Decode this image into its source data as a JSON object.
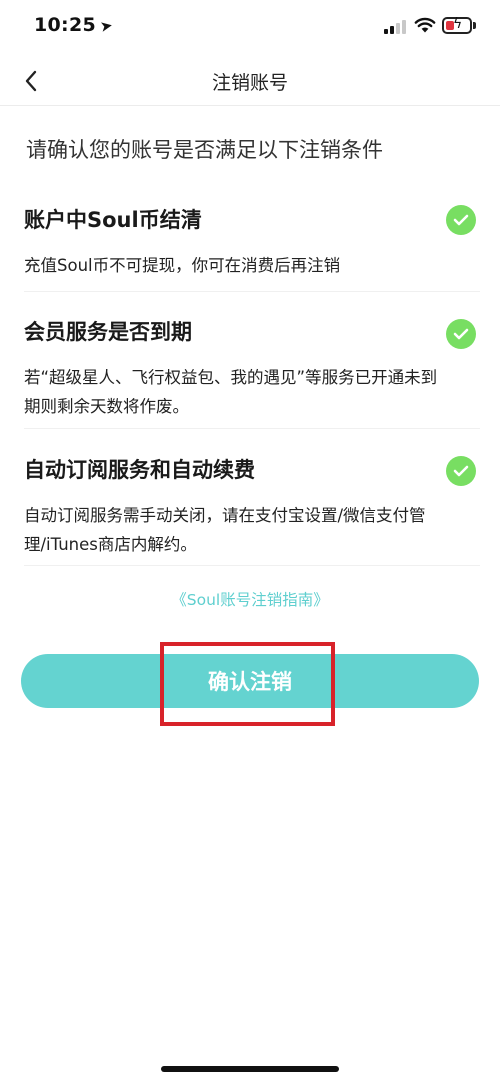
{
  "status_bar": {
    "time": "10:25",
    "location_icon": "location-arrow-icon",
    "signal_icon": "cellular-signal-icon",
    "wifi_icon": "wifi-icon",
    "battery_icon": "battery-charging-icon",
    "battery_color": "#e0343f"
  },
  "nav": {
    "back_icon": "chevron-left-icon",
    "title": "注销账号"
  },
  "intro": "请确认您的账号是否满足以下注销条件",
  "conditions": [
    {
      "title": "账户中Soul币结清",
      "desc": "充值Soul币不可提现，你可在消费后再注销",
      "icon": "check-circle-icon"
    },
    {
      "title": "会员服务是否到期",
      "desc": "若“超级星人、飞行权益包、我的遇见”等服务已开通未到期则剩余天数将作废。",
      "icon": "check-circle-icon"
    },
    {
      "title": "自动订阅服务和自动续费",
      "desc": "自动订阅服务需手动关闭，请在支付宝设置/微信支付管理/iTunes商店内解约。",
      "icon": "check-circle-icon"
    }
  ],
  "guide_link": "《Soul账号注销指南》",
  "confirm_button": "确认注销",
  "colors": {
    "accent": "#64d3d0",
    "link": "#5fcfcf",
    "check": "#78de62",
    "highlight": "#d8232a"
  }
}
